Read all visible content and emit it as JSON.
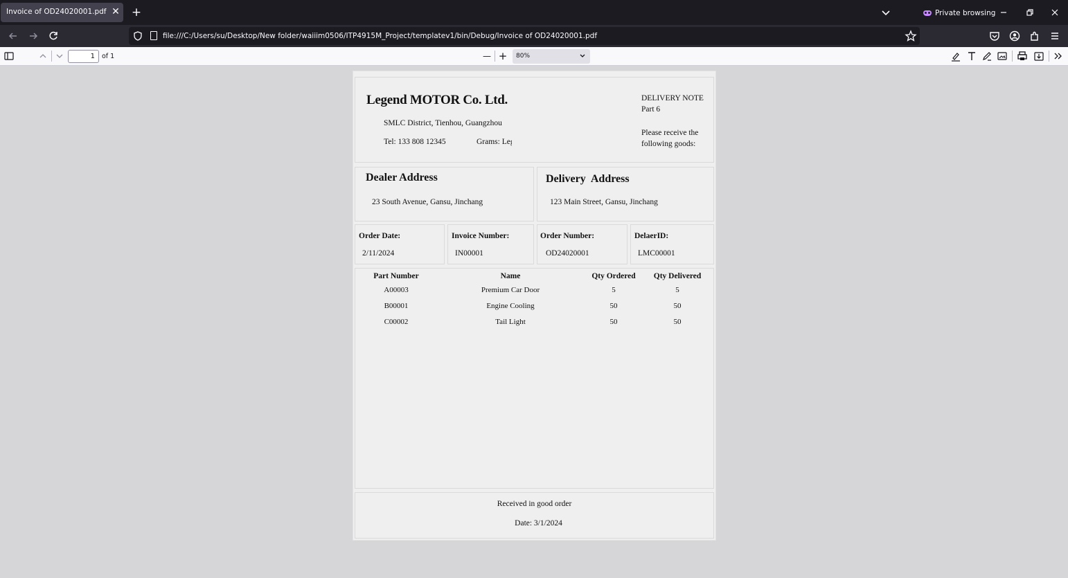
{
  "browser": {
    "tab_title": "Invoice of OD24020001.pdf",
    "tab_close": "✕",
    "new_tab": "+",
    "private_label": "Private browsing",
    "url": "file:///C:/Users/su/Desktop/New folder/waiiim0506/ITP4915M_Project/templatev1/bin/Debug/Invoice of OD24020001.pdf",
    "icons": [
      "back-icon",
      "forward-icon",
      "reload-icon",
      "shield-icon",
      "page-icon",
      "bookmark-star-icon",
      "pocket-icon",
      "account-icon",
      "extensions-icon",
      "menu-icon"
    ]
  },
  "pdf_toolbar": {
    "page_number": "1",
    "page_count": "of 1",
    "zoom": "80%",
    "zoom_out": "—",
    "zoom_in": "+"
  },
  "document": {
    "company_name": "Legend MOTOR Co. Ltd.",
    "company_address": "SMLC District, Tienhou, Guangzhou",
    "telephone": "Tel: 133 808 12345",
    "grams": "Grams: Legend",
    "note_title": "DELIVERY NOTE",
    "note_part": "Part 6",
    "note_message": "Please receive the following goods:",
    "dealer_title": "Dealer Address",
    "dealer_address": "23 South Avenue, Gansu, Jinchang",
    "delivery_title": "Delivery  Address",
    "delivery_address": "123 Main Street, Gansu, Jinchang",
    "order_date_label": "Order Date:",
    "order_date": "2/11/2024",
    "invoice_number_label": "Invoice Number:",
    "invoice_number": "IN00001",
    "order_number_label": "Order Number:",
    "order_number": "OD24020001",
    "dealer_id_label": "DelaerID:",
    "dealer_id": "LMC00001",
    "table": {
      "headers": [
        "Part Number",
        "Name",
        "Qty Ordered",
        "Qty Delivered"
      ],
      "rows": [
        [
          "A00003",
          "Premium Car Door",
          "5",
          "5"
        ],
        [
          "B00001",
          "Engine Cooling",
          "50",
          "50"
        ],
        [
          "C00002",
          "Tail Light",
          "50",
          "50"
        ]
      ]
    },
    "received_text": "Received in good order",
    "received_date": "Date: 3/1/2024"
  }
}
